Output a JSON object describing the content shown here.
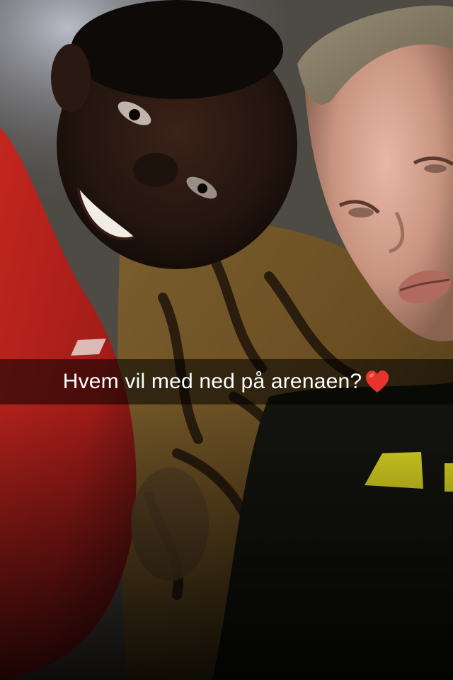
{
  "snap": {
    "caption": "Hvem vil med ned på arenaen?",
    "caption_emoji": "heart-icon"
  },
  "colors": {
    "caption_bar": "rgba(0,0,0,0.55)",
    "caption_text": "#ffffff",
    "heart": "#e8322d",
    "red_jacket": "#b5201c",
    "tiger_blanket": "#6e5428",
    "yellow_logo": "#e8e020"
  }
}
